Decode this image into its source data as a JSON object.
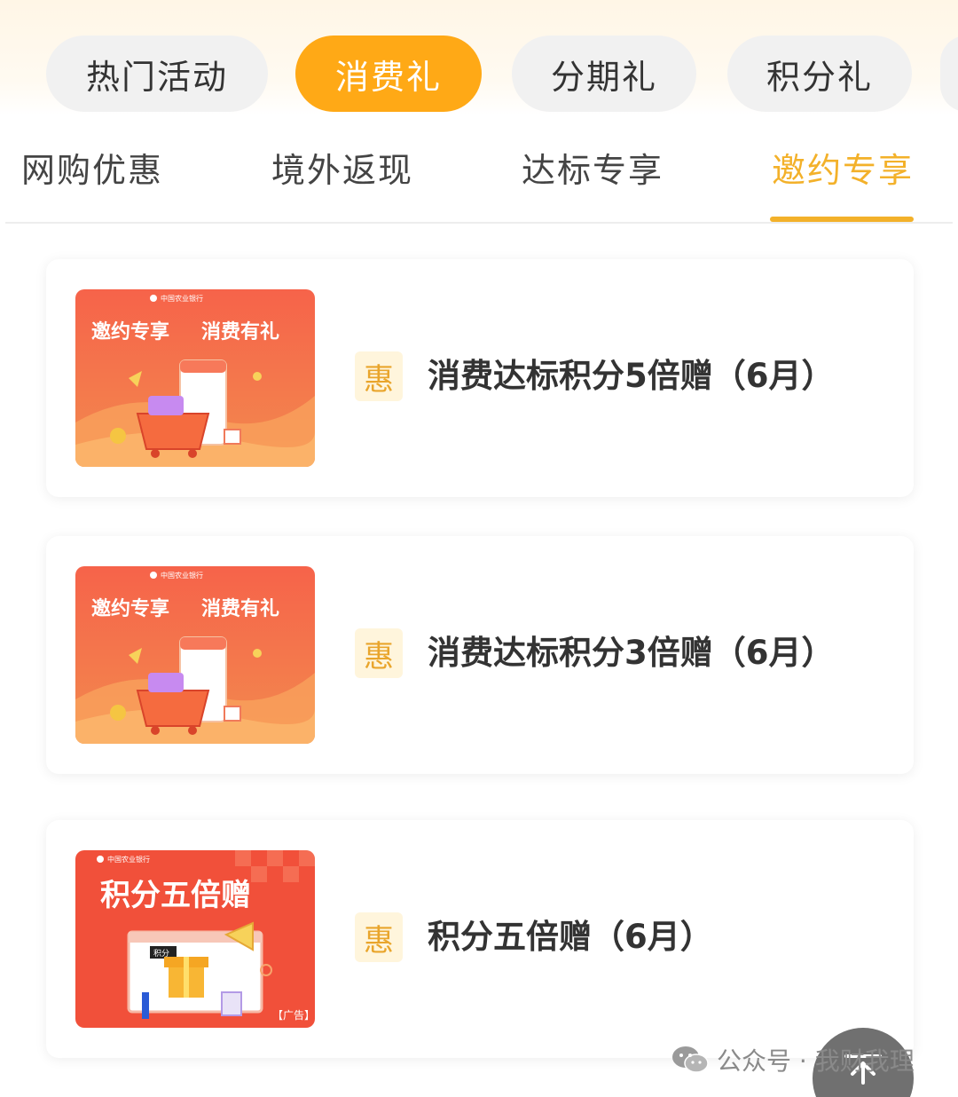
{
  "pill_tabs": [
    {
      "label": "热门活动",
      "active": false
    },
    {
      "label": "消费礼",
      "active": true
    },
    {
      "label": "分期礼",
      "active": false
    },
    {
      "label": "积分礼",
      "active": false
    }
  ],
  "sub_tabs": [
    {
      "label": "网购优惠",
      "active": false
    },
    {
      "label": "境外返现",
      "active": false
    },
    {
      "label": "达标专享",
      "active": false
    },
    {
      "label": "邀约专享",
      "active": true
    }
  ],
  "cards": [
    {
      "badge": "惠",
      "title": "消费达标积分5倍赠（6月）",
      "thumb": {
        "bank": "中国农业银行",
        "headline_left": "邀约专享",
        "headline_right": "消费有礼"
      }
    },
    {
      "badge": "惠",
      "title": "消费达标积分3倍赠（6月）",
      "thumb": {
        "bank": "中国农业银行",
        "headline_left": "邀约专享",
        "headline_right": "消费有礼"
      }
    },
    {
      "badge": "惠",
      "title": "积分五倍赠（6月）",
      "thumb": {
        "bank": "中国农业银行",
        "headline": "积分五倍赠",
        "tag": "积分",
        "ad_label": "【广告】"
      }
    }
  ],
  "watermark": {
    "text": "公众号 · 我财我理",
    "icon": "wechat-icon"
  },
  "back_to_top": {
    "icon": "arrow-up-icon"
  },
  "colors": {
    "accent": "#ffa916",
    "active_subtab": "#f3b12a",
    "badge_bg": "#fff5dc",
    "thumb_red": "#f1503a"
  }
}
